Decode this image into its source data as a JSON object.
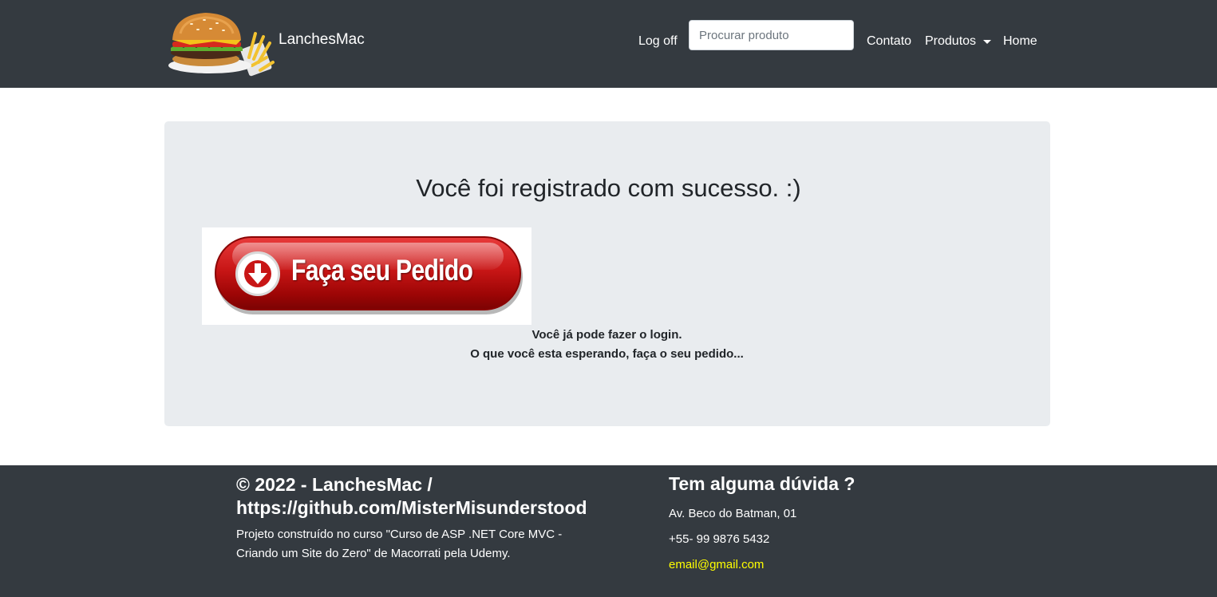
{
  "navbar": {
    "brand_name": "LanchesMac",
    "logoff_label": "Log off",
    "search_placeholder": "Procurar produto",
    "search_value": "",
    "contato_label": "Contato",
    "produtos_label": "Produtos",
    "home_label": "Home",
    "logo_icon": "burger-fries-logo-icon"
  },
  "main": {
    "title": "Você foi registrado com sucesso. :)",
    "order_button_label": "Faça seu Pedido",
    "order_button_icon": "download-arrow-icon",
    "message_line1": "Você já pode fazer o login.",
    "message_line2": "O que você esta esperando, faça o seu pedido..."
  },
  "footer": {
    "copyright": "© 2022 - LanchesMac / https://github.com/MisterMisunderstood",
    "description": "Projeto construído no curso \"Curso de ASP .NET Core MVC - Criando um Site do Zero\" de Macorrati pela Udemy.",
    "question_title": "Tem alguma dúvida ?",
    "address": "Av. Beco do Batman, 01",
    "phone": "+55- 99 9876 5432",
    "email": "email@gmail.com"
  },
  "colors": {
    "navbar_bg": "#343a40",
    "jumbotron_bg": "#e9ecef",
    "email_color": "#ffff00",
    "order_button_red": "#c81616"
  }
}
